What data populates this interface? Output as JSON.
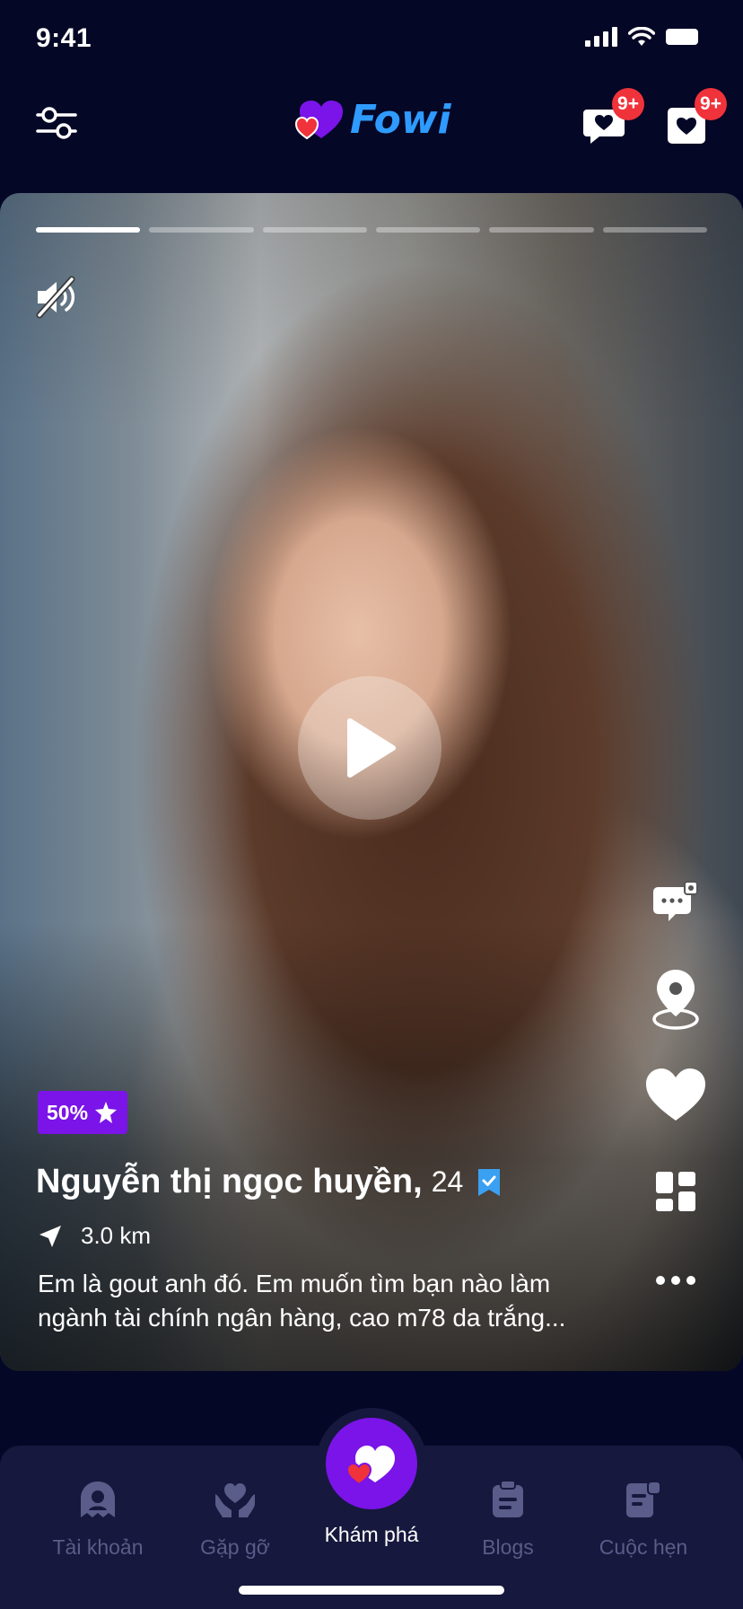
{
  "status_bar": {
    "time": "9:41"
  },
  "header": {
    "logo_text": "Fowi",
    "chat_badge": "9+",
    "likes_badge": "9+"
  },
  "profile": {
    "story_segments": 6,
    "active_segment": 1,
    "discount": "50%",
    "name": "Nguyễn thị ngọc huyền,",
    "age": "24",
    "distance": "3.0 km",
    "bio_line1": "Em là gout anh đó. Em muốn tìm bạn nào làm",
    "bio_line2": "ngành tài chính ngân hàng, cao m78 da trắng..."
  },
  "bottom_nav": {
    "items": [
      {
        "label": "Tài khoản",
        "icon": "ghost-icon"
      },
      {
        "label": "Gặp gỡ",
        "icon": "hand-heart-icon"
      },
      {
        "label": "Khám phá",
        "icon": "hearts-icon"
      },
      {
        "label": "Blogs",
        "icon": "clipboard-icon"
      },
      {
        "label": "Cuộc hẹn",
        "icon": "calendar-note-icon"
      }
    ]
  },
  "colors": {
    "background": "#050726",
    "accent": "#7a14e8",
    "badge": "#f0323a",
    "logo_blue": "#2f9bff",
    "verified": "#3aa0f2"
  }
}
